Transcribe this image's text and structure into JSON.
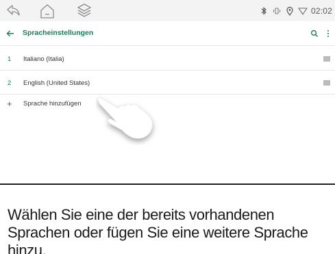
{
  "status_bar": {
    "time": "02:02",
    "icons": [
      "bluetooth-icon",
      "vibrate-icon",
      "location-icon",
      "wifi-icon"
    ]
  },
  "nav_bar": {
    "icons": [
      "back-icon",
      "home-icon",
      "recents-icon"
    ]
  },
  "app_bar": {
    "title": "Spracheinstellungen",
    "accent_color": "#1f7a55",
    "actions": [
      "search-icon",
      "more-vert-icon"
    ]
  },
  "languages": [
    {
      "index": "1",
      "label": "Italiano (Italia)"
    },
    {
      "index": "2",
      "label": "English (United States)"
    }
  ],
  "add_language": {
    "symbol": "+",
    "label": "Sprache hinzufügen"
  },
  "caption": {
    "text": "Wählen Sie eine der bereits vorhandenen Sprachen oder fügen Sie eine weitere Sprache hinzu."
  }
}
